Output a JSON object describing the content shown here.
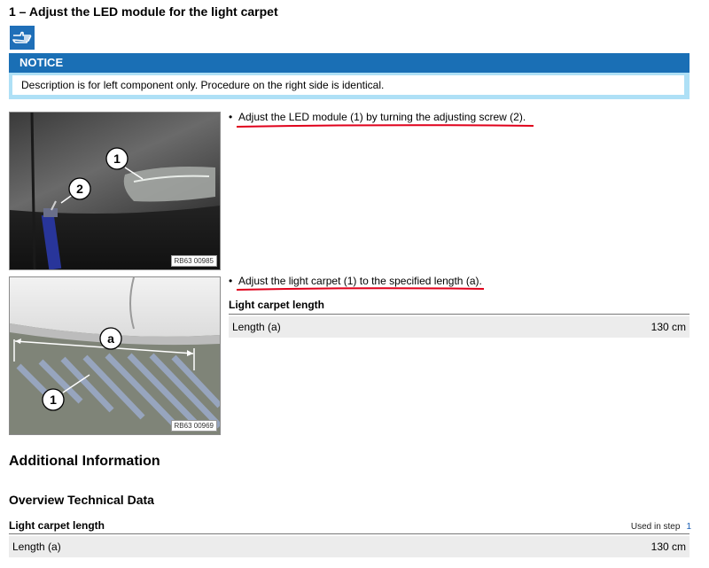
{
  "title": "1 – Adjust the LED module for the light carpet",
  "notice": {
    "header": "NOTICE",
    "text": "Description is for left component only. Procedure on the right side is identical."
  },
  "images": [
    {
      "ref": "RB63 00985",
      "callouts": [
        "1",
        "2"
      ]
    },
    {
      "ref": "RB63 00969",
      "callouts": [
        "a",
        "1"
      ]
    }
  ],
  "steps": [
    {
      "bullet": "•",
      "text": "Adjust the LED module (1) by turning the adjusting screw (2)."
    },
    {
      "bullet": "•",
      "text": "Adjust the light carpet (1) to the specified length (a)."
    }
  ],
  "table": {
    "title": "Light carpet length",
    "rows": [
      {
        "label": "Length (a)",
        "value": "130 cm"
      }
    ]
  },
  "additional_info": "Additional Information",
  "overview": "Overview Technical Data",
  "table2": {
    "title": "Light carpet length",
    "used_in_step_label": "Used in step",
    "used_in_step_link": "1",
    "rows": [
      {
        "label": "Length (a)",
        "value": "130 cm"
      }
    ]
  },
  "colors": {
    "notice_header": "#1a6fb5",
    "notice_bg": "#aee0f6",
    "accent": "#1f6fb8",
    "underline": "#e0001b"
  },
  "icons": {
    "instruction": "pointing-hand-icon"
  }
}
